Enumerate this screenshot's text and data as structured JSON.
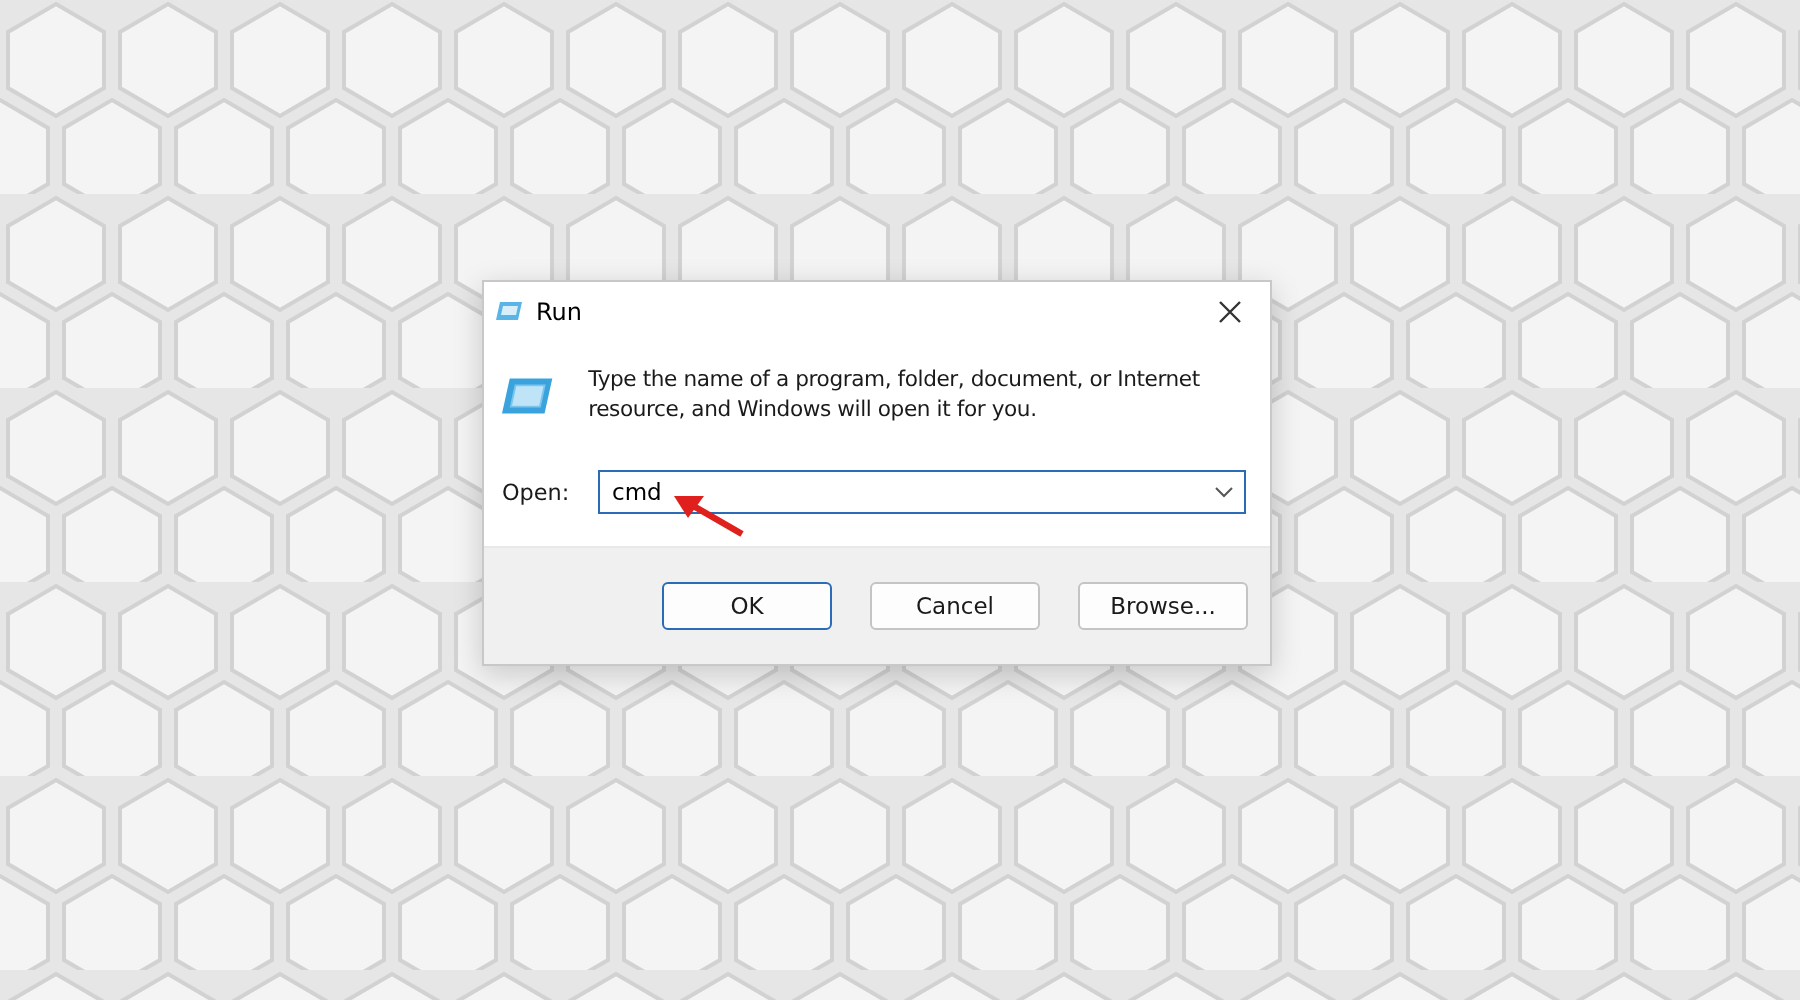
{
  "window": {
    "title": "Run"
  },
  "message": "Type the name of a program, folder, document, or Internet resource, and Windows will open it for you.",
  "open_field": {
    "label": "Open:",
    "value": "cmd"
  },
  "buttons": [
    {
      "label": "OK",
      "default": true
    },
    {
      "label": "Cancel",
      "default": false
    },
    {
      "label": "Browse...",
      "default": false
    }
  ]
}
